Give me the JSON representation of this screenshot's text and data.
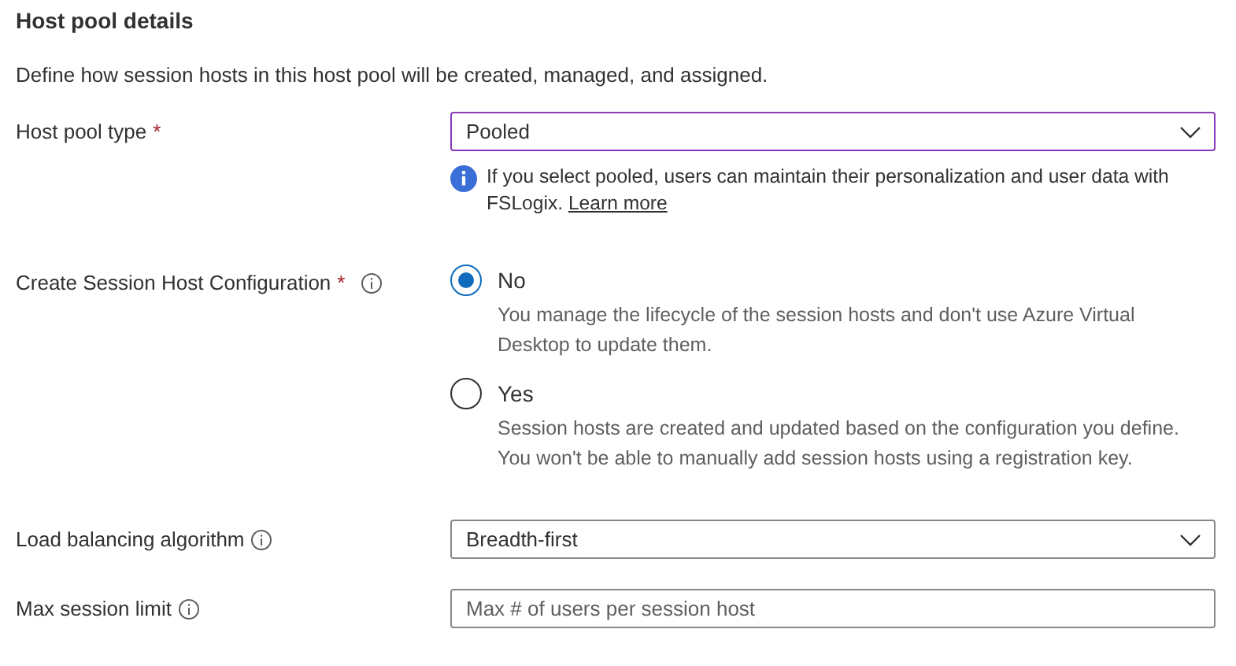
{
  "section": {
    "title": "Host pool details",
    "description": "Define how session hosts in this host pool will be created, managed, and assigned."
  },
  "fields": [
    {
      "kind": "select",
      "label": "Host pool type",
      "required_mark": "*",
      "info": false,
      "value": "Pooled",
      "focused": true,
      "note": {
        "text": "If you select pooled, users can maintain their personalization and user data with FSLogix.",
        "link": "Learn more"
      }
    },
    {
      "kind": "radio",
      "label": "Create Session Host Configuration",
      "required_mark": "*",
      "info": true,
      "options": [
        {
          "label": "No",
          "selected": true,
          "description": "You manage the lifecycle of the session hosts and don't use Azure Virtual Desktop to update them."
        },
        {
          "label": "Yes",
          "selected": false,
          "description": "Session hosts are created and updated based on the configuration you define. You won't be able to manually add session hosts using a registration key."
        }
      ]
    },
    {
      "kind": "select",
      "label": "Load balancing algorithm",
      "info": true,
      "value": "Breadth-first",
      "focused": false
    },
    {
      "kind": "text",
      "label": "Max session limit",
      "info": true,
      "placeholder": "Max # of users per session host"
    }
  ]
}
